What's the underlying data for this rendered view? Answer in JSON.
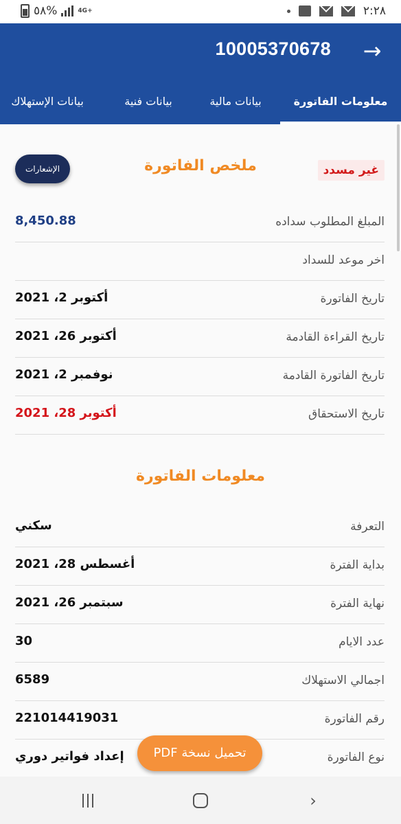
{
  "status_bar": {
    "battery_percent": "٥٨%",
    "network": "4G+",
    "time": "٢:٢٨"
  },
  "app_bar": {
    "title": "10005370678",
    "back_icon": "arrow-right-icon"
  },
  "tabs": [
    {
      "label": "معلومات الفاتورة",
      "active": true
    },
    {
      "label": "بيانات مالية",
      "active": false
    },
    {
      "label": "بيانات فنية",
      "active": false
    },
    {
      "label": "بيانات الإستهلاك",
      "active": false
    }
  ],
  "summary": {
    "status_badge": "غير مسدد",
    "title": "ملخص الفاتورة",
    "notifications_button": "الإشعارات",
    "rows": [
      {
        "label": "المبلغ المطلوب سداده",
        "value": "8,450.88"
      },
      {
        "label": "اخر موعد للسداد",
        "value": ""
      },
      {
        "label": "تاريخ الفاتورة",
        "value": "أكتوبر 2، 2021"
      },
      {
        "label": "تاريخ القراءة القادمة",
        "value": "أكتوبر 26، 2021"
      },
      {
        "label": "تاريخ الفاتورة القادمة",
        "value": "نوفمبر 2، 2021"
      },
      {
        "label": "تاريخ الاستحقاق",
        "value": "أكتوبر 28، 2021"
      }
    ]
  },
  "invoice_info": {
    "title": "معلومات الفاتورة",
    "rows": [
      {
        "label": "التعرفة",
        "value": "سكني"
      },
      {
        "label": "بداية الفترة",
        "value": "أغسطس 28، 2021"
      },
      {
        "label": "نهاية الفترة",
        "value": "سبتمبر 26، 2021"
      },
      {
        "label": "عدد الايام",
        "value": "30"
      },
      {
        "label": "اجمالي الاستهلاك",
        "value": "6589"
      },
      {
        "label": "رقم الفاتورة",
        "value": "221014419031"
      },
      {
        "label": "نوع الفاتورة",
        "value": "إعداد فواتير دوري"
      }
    ]
  },
  "fab": {
    "label": "تحميل نسخة PDF"
  },
  "colors": {
    "primary": "#1f4e9e",
    "accent": "#f08a24",
    "danger": "#d21a1a"
  }
}
